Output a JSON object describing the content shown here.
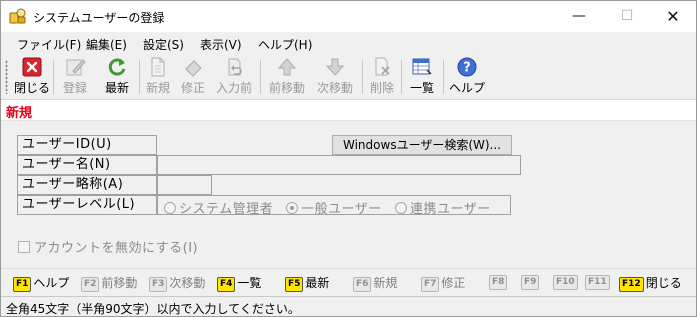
{
  "window": {
    "title": "システムユーザーの登録",
    "controls": {
      "minimize": "—",
      "maximize": "☐",
      "close": "✕"
    }
  },
  "menu": [
    {
      "label": "ファイル(F)"
    },
    {
      "label": "編集(E)"
    },
    {
      "label": "設定(S)"
    },
    {
      "label": "表示(V)"
    },
    {
      "label": "ヘルプ(H)"
    }
  ],
  "toolbar": {
    "close": "閉じる",
    "register": "登録",
    "refresh": "最新",
    "new": "新規",
    "modify": "修正",
    "input_prev": "入力前",
    "prev_move": "前移動",
    "next_move": "次移動",
    "delete": "削除",
    "list": "一覧",
    "help": "ヘルプ"
  },
  "mode": "新規",
  "form": {
    "user_id_label": "ユーザーID(U)",
    "user_id_value": "",
    "windows_search_button": "Windowsユーザー検索(W)...",
    "user_name_label": "ユーザー名(N)",
    "user_abbr_label": "ユーザー略称(A)",
    "user_level_label": "ユーザーレベル(L)",
    "level_options": [
      {
        "label": "システム管理者",
        "selected": false
      },
      {
        "label": "一般ユーザー",
        "selected": true
      },
      {
        "label": "連携ユーザー",
        "selected": false
      }
    ],
    "disable_account_label": "アカウントを無効にする(I)"
  },
  "fkeys": [
    {
      "key": "F1",
      "label": "ヘルプ",
      "enabled": true
    },
    {
      "key": "F2",
      "label": "前移動",
      "enabled": false
    },
    {
      "key": "F3",
      "label": "次移動",
      "enabled": false
    },
    {
      "key": "F4",
      "label": "一覧",
      "enabled": true
    },
    {
      "key": "F5",
      "label": "最新",
      "enabled": true
    },
    {
      "key": "F6",
      "label": "新規",
      "enabled": false
    },
    {
      "key": "F7",
      "label": "修正",
      "enabled": false
    },
    {
      "key": "F8",
      "label": "",
      "enabled": false
    },
    {
      "key": "F9",
      "label": "",
      "enabled": false
    },
    {
      "key": "F10",
      "label": "",
      "enabled": false
    },
    {
      "key": "F11",
      "label": "",
      "enabled": false
    },
    {
      "key": "F12",
      "label": "閉じる",
      "enabled": true
    }
  ],
  "status": "全角45文字（半角90文字）以内で入力してください。",
  "colors": {
    "mode_red": "#e8001c",
    "fkey_active": "#ffe400"
  }
}
